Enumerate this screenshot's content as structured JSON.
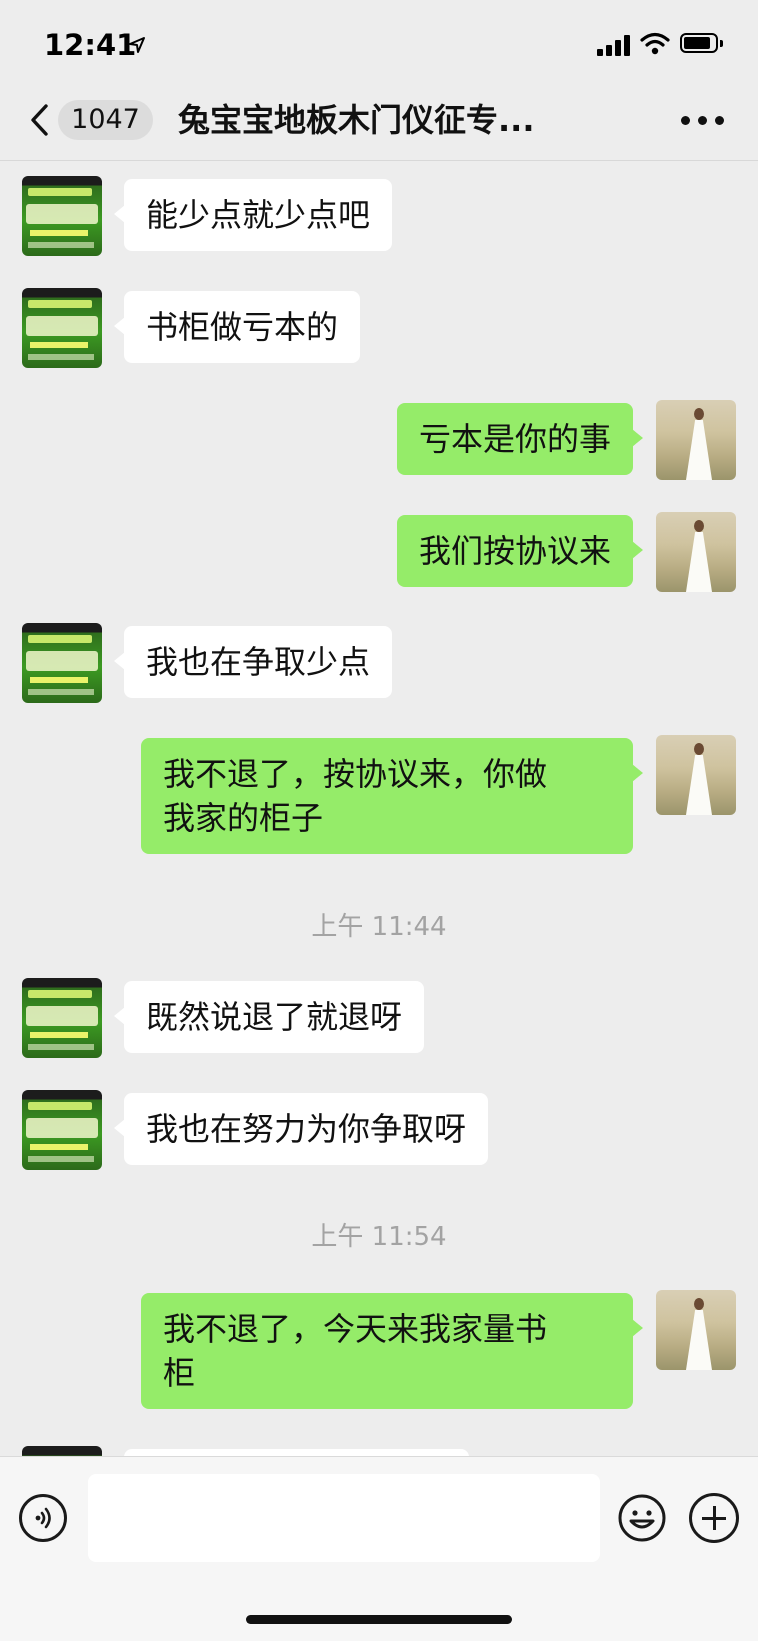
{
  "status_bar": {
    "time": "12:41"
  },
  "nav": {
    "unread_count": "1047",
    "title": "兔宝宝地板木门仪征专..."
  },
  "messages": [
    {
      "side": "in",
      "text": "能少点就少点吧",
      "avatar": "shop-avatar"
    },
    {
      "side": "in",
      "text": "书柜做亏本的",
      "avatar": "shop-avatar"
    },
    {
      "side": "out",
      "text": "亏本是你的事",
      "avatar": "user-avatar"
    },
    {
      "side": "out",
      "text": "我们按协议来",
      "avatar": "user-avatar"
    },
    {
      "side": "in",
      "text": "我也在争取少点",
      "avatar": "shop-avatar"
    },
    {
      "side": "out",
      "text": "我不退了，按协议来，你做\n我家的柜子",
      "avatar": "user-avatar"
    },
    {
      "timestamp": "上午 11:44"
    },
    {
      "side": "in",
      "text": "既然说退了就退呀",
      "avatar": "shop-avatar"
    },
    {
      "side": "in",
      "text": "我也在努力为你争取呀",
      "avatar": "shop-avatar"
    },
    {
      "timestamp": "上午 11:54"
    },
    {
      "side": "out",
      "text": "我不退了，今天来我家量书\n柜",
      "avatar": "user-avatar"
    }
  ],
  "input_bar": {
    "placeholder": ""
  },
  "icons": {
    "back": "chevron-left-icon",
    "more": "more-dots-icon",
    "voice": "voice-icon",
    "emoji": "emoji-icon",
    "plus": "plus-icon"
  },
  "colors": {
    "background": "#ededed",
    "outgoing_bubble": "#95ec69",
    "incoming_bubble": "#ffffff",
    "timestamp_text": "#a3a3a3"
  }
}
